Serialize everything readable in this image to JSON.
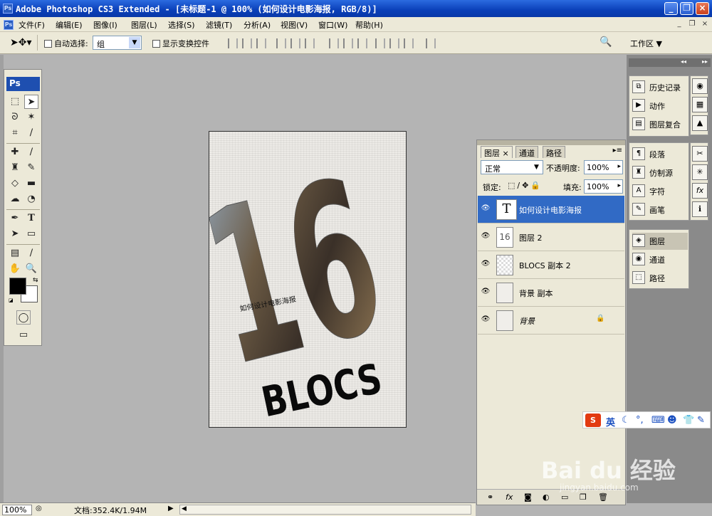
{
  "window": {
    "title": "Adobe Photoshop CS3 Extended - [未标题-1 @ 100% (如何设计电影海报, RGB/8)]",
    "app_icon": "Ps"
  },
  "menu": [
    "文件(F)",
    "编辑(E)",
    "图像(I)",
    "图层(L)",
    "选择(S)",
    "滤镜(T)",
    "分析(A)",
    "视图(V)",
    "窗口(W)",
    "帮助(H)"
  ],
  "menu_icon": "Ps",
  "options": {
    "auto_select_label": "自动选择:",
    "auto_select_value": "组",
    "show_transform_label": "显示变换控件",
    "workspace_label": "工作区 ▼"
  },
  "toolbox": {
    "logo": "Ps"
  },
  "poster": {
    "numerals": "16",
    "caption": "如何设计电影海报",
    "word": "BLOCS"
  },
  "layers_panel": {
    "tabs": [
      "图层",
      "通道",
      "路径"
    ],
    "blend_mode": "正常",
    "opacity_label": "不透明度:",
    "opacity_value": "100%",
    "lock_label": "锁定:",
    "fill_label": "填充:",
    "fill_value": "100%",
    "layers": [
      {
        "name": "如何设计电影海报",
        "thumb": "T",
        "selected": true
      },
      {
        "name": "图层 2",
        "thumb": "16",
        "selected": false
      },
      {
        "name": "BLOCS 副本 2",
        "thumb": "",
        "selected": false
      },
      {
        "name": "背景 副本",
        "thumb": "",
        "selected": false
      },
      {
        "name": "背景",
        "thumb": "",
        "selected": false,
        "locked": true
      }
    ]
  },
  "dock": {
    "group1": [
      "历史记录",
      "动作",
      "图层复合"
    ],
    "group2": [
      "段落",
      "仿制源",
      "字符",
      "画笔"
    ],
    "group3": [
      "图层",
      "通道",
      "路径"
    ]
  },
  "ime": {
    "label": "英"
  },
  "watermark": {
    "brand": "Bai du 经验",
    "url": "jingyan.baidu.com"
  },
  "status": {
    "zoom": "100%",
    "doc": "文档:352.4K/1.94M"
  }
}
